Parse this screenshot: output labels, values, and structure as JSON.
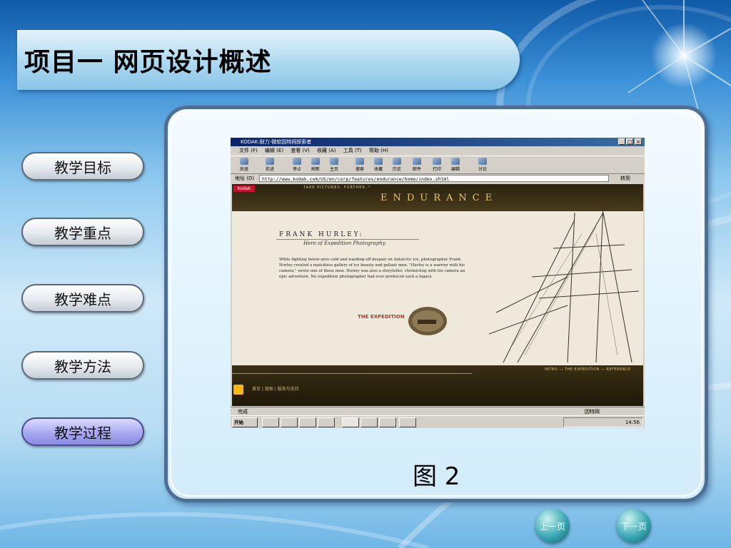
{
  "slide": {
    "title": "项目一 网页设计概述",
    "figure_caption": "图 2"
  },
  "nav": {
    "items": [
      {
        "label": "教学目标",
        "active": false
      },
      {
        "label": "教学重点",
        "active": false
      },
      {
        "label": "教学难点",
        "active": false
      },
      {
        "label": "教学方法",
        "active": false
      },
      {
        "label": "教学过程",
        "active": true
      }
    ]
  },
  "pager": {
    "prev_label": "上一页",
    "next_label": "下一页"
  },
  "browser": {
    "window_title": "KODAK:耐力-微软因特网探索者",
    "menu": [
      "文件 (F)",
      "编辑 (E)",
      "查看 (V)",
      "收藏 (A)",
      "工具 (T)",
      "帮助 (H)"
    ],
    "toolbar": [
      "后退",
      "前进",
      "停止",
      "刷新",
      "主页",
      "搜索",
      "收藏",
      "历史",
      "邮件",
      "打印",
      "编辑",
      "讨论"
    ],
    "address_label": "地址 (D)",
    "url": "http://www.kodak.com/US/en/corp/features/endurance/home/index.shtml",
    "go_label": "转到",
    "status_left": "完成",
    "status_right": "因特网",
    "start_label": "开始",
    "clock": "14:56"
  },
  "webpage": {
    "brand": "Kodak",
    "tagline": "TAKE PICTURES. FURTHER.™",
    "site_title": "ENDURANCE",
    "heading": "FRANK HURLEY:",
    "subheading": "Hero of Expedition Photography",
    "body": "While fighting below-zero cold and warding off despair on Antarctic ice, photographer Frank Hurley created a matchless gallery of icy beauty and gallant men. \"Hurley is a warrior with his camera,\" wrote one of those men. Hurley was also a storyteller, chronicling with his camera an epic adventure. No expedition photographer had ever produced such a legacy.",
    "expedition_link": "THE EXPEDITION",
    "bottom_nav": "INTRO — THE EXPEDITION — REFERENCE",
    "footer_links": "首页  |  搜索  |  服务与支持"
  },
  "colors": {
    "title_bar": "#a9d6ef",
    "panel_border": "#4e6f93",
    "active_nav": "#a8a8f0"
  }
}
